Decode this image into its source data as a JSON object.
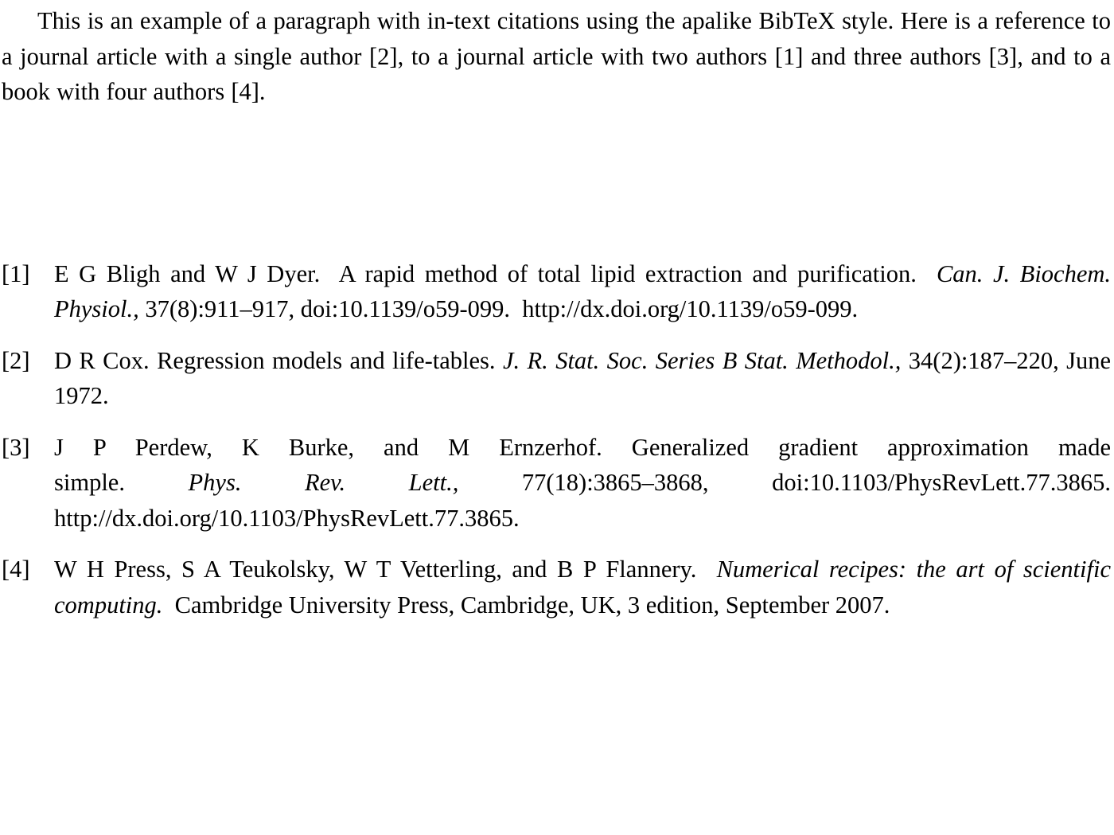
{
  "document": {
    "intro": {
      "text": "This is an example of a paragraph with in-text citations using the apalike BibTeX style. Here is a reference to a journal article with a single author [2], to a journal article with two authors [1] and three authors [3], and to a book with four authors [4]."
    },
    "bibliography": {
      "entries": [
        {
          "label": "[1]",
          "authors": "E G Bligh and W J Dyer.",
          "title": "A rapid method of total lipid extraction and purification.",
          "journal": "Can. J. Biochem. Physiol.,",
          "volume_pages": "37(8):911–917,",
          "doi": "doi:10.1139/o59-099.",
          "url": "http://dx.doi.org/10.1139/o59-099."
        },
        {
          "label": "[2]",
          "authors": "D R Cox.",
          "title": "Regression models and life-tables.",
          "journal": "J. R. Stat. Soc. Series B Stat. Methodol.,",
          "volume_pages": "34(2):187–220,",
          "date": "June 1972."
        },
        {
          "label": "[3]",
          "authors": "J P Perdew, K Burke, and M Ernzerhof.",
          "title": "Generalized gradient approximation made simple.",
          "journal": "Phys. Rev. Lett.,",
          "volume_pages": "77(18):3865–3868,",
          "doi": "doi:10.1103/PhysRevLett.77.3865.",
          "url": "http://dx.doi.org/10.1103/PhysRevLett.77.3865."
        },
        {
          "label": "[4]",
          "authors": "W H Press, S A Teukolsky, W T Vetterling, and B P Flannery.",
          "title": "Numerical recipes: the art of scientific computing.",
          "publisher": "Cambridge University Press,",
          "place": "Cambridge, UK,",
          "edition": "3 edition,",
          "date": "September 2007."
        }
      ]
    }
  }
}
